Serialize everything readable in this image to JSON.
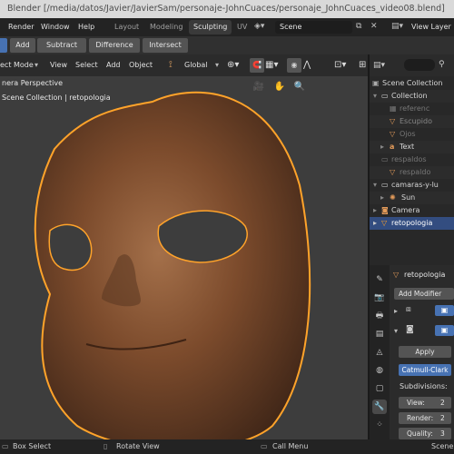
{
  "window": {
    "title": "Blender [/media/datos/Javier/JavierSam/personaje-JohnCuaces/personaje_JohnCuaces_video08.blend]"
  },
  "menu": {
    "items": [
      "Render",
      "Window",
      "Help"
    ]
  },
  "workspaces": {
    "tabs": [
      "Layout",
      "Modeling",
      "Sculpting",
      "UV"
    ],
    "active": "Sculpting"
  },
  "scene": {
    "name": "Scene"
  },
  "view_layer": {
    "name": "View Layer"
  },
  "boolean_bar": {
    "buttons": [
      "Add",
      "Subtract",
      "Difference",
      "Intersect"
    ]
  },
  "viewport_header": {
    "mode": "ect Mode",
    "menus": [
      "View",
      "Select",
      "Add",
      "Object"
    ],
    "orientation": "Global"
  },
  "viewport": {
    "perspective": "nera Perspective",
    "collection": "Scene Collection | retopologia"
  },
  "outliner": {
    "rows": [
      {
        "label": "Scene Collection",
        "icon": "scene-collection-icon"
      },
      {
        "label": "Collection",
        "icon": "collection-icon"
      },
      {
        "label": "referenc",
        "icon": "image-icon"
      },
      {
        "label": "Escupido",
        "icon": "mesh-icon"
      },
      {
        "label": "Ojos",
        "icon": "mesh-icon"
      },
      {
        "label": "Text",
        "icon": "text-icon"
      },
      {
        "label": "respaldos",
        "icon": "collection-icon"
      },
      {
        "label": "respaldo",
        "icon": "mesh-icon"
      },
      {
        "label": "camaras-y-lu",
        "icon": "collection-icon"
      },
      {
        "label": "Sun",
        "icon": "light-icon"
      },
      {
        "label": "Camera",
        "icon": "camera-icon"
      },
      {
        "label": "retopologia",
        "icon": "mesh-icon"
      }
    ]
  },
  "properties": {
    "object_name": "retopologia",
    "add_modifier": "Add Modifier",
    "apply": "Apply",
    "subdiv_type": "Catmull-Clark",
    "subdivisions_label": "Subdivisions:",
    "view": {
      "label": "View:",
      "value": "2"
    },
    "render": {
      "label": "Render:",
      "value": "2"
    },
    "quality": {
      "label": "Quality:",
      "value": "3"
    }
  },
  "statusbar": {
    "items": [
      "Box Select",
      "Rotate View",
      "Call Menu",
      "Scene"
    ]
  },
  "colors": {
    "accent_blue": "#4772b3",
    "selection_orange": "#ffa32a",
    "face_brown": "#7a4a2a"
  }
}
